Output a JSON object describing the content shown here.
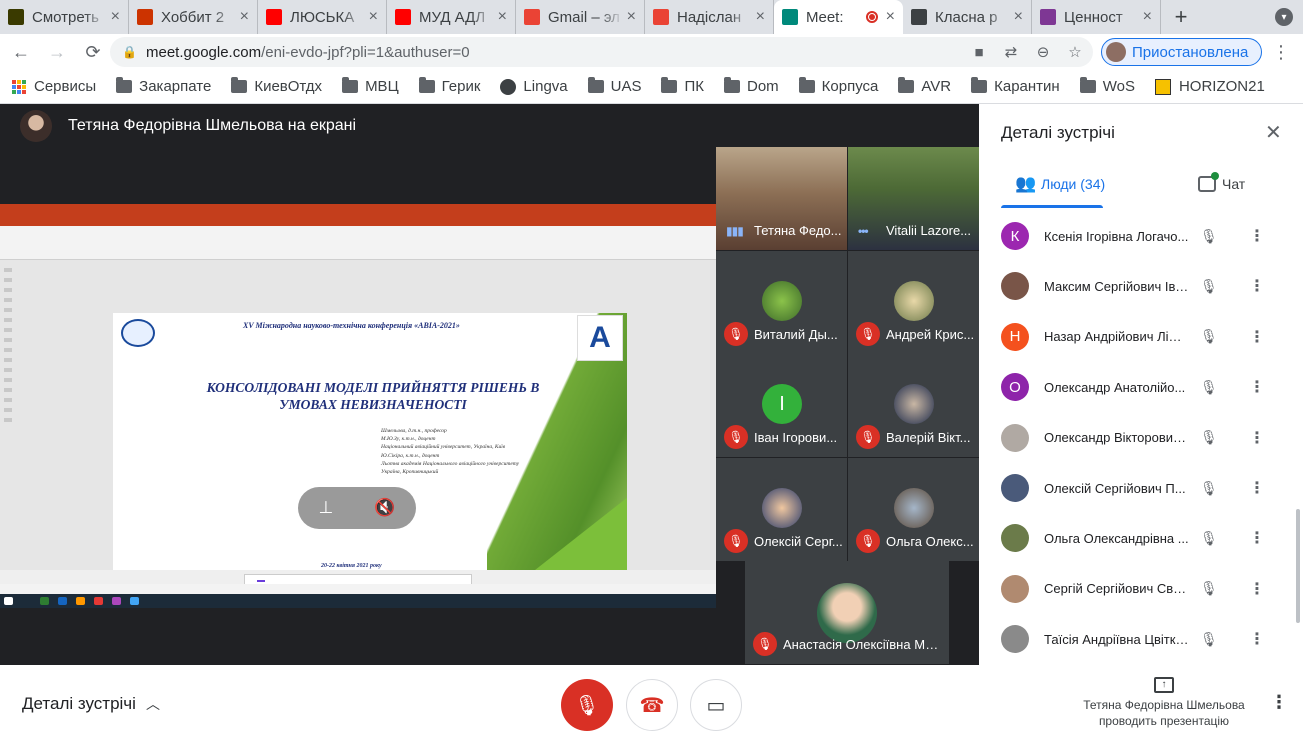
{
  "tabs": [
    {
      "title": "Смотреть",
      "icon": "d-favicon",
      "color": "#3a3a00"
    },
    {
      "title": "Хоббит 2",
      "icon": "k-favicon",
      "color": "#cc3300"
    },
    {
      "title": "ЛЮСЬКА",
      "icon": "youtube-icon",
      "color": "#ff0000"
    },
    {
      "title": "МУД АДЛ",
      "icon": "youtube-icon",
      "color": "#ff0000"
    },
    {
      "title": "Gmail – эл",
      "icon": "gmail-icon",
      "color": "#ea4335"
    },
    {
      "title": "Надіслан",
      "icon": "gmail-icon",
      "color": "#ea4335"
    },
    {
      "title": "Meet:",
      "icon": "meet-icon",
      "color": "#00897b",
      "active": true
    },
    {
      "title": "Класна р",
      "icon": "classroom-icon",
      "color": "#3c4043"
    },
    {
      "title": "Ценност",
      "icon": "bookmark-icon",
      "color": "#7e3794"
    }
  ],
  "tab_close": "×",
  "new_tab": "+",
  "omnibox": {
    "host": "meet.google.com",
    "path": "/eni-evdo-jpf?pli=1&authuser=0"
  },
  "profile_label": "Приостановлена",
  "bookmarks": [
    "Сервисы",
    "Закарпате",
    "КиевОтдх",
    "МВЦ",
    "Герик",
    "Lingva",
    "UAS",
    "ПК",
    "Dom",
    "Корпуса",
    "AVR",
    "Карантин",
    "WoS",
    "HORIZON21"
  ],
  "stage": {
    "presenter_text": "Тетяна Федорівна Шмельова на екрані"
  },
  "slide": {
    "conference": "XV Міжнародна науково-технічна конференція «АВІА-2021»",
    "title_line1": "КОНСОЛІДОВАНІ МОДЕЛІ  ПРИЙНЯТТЯ РІШЕНЬ В",
    "title_line2": "УМОВАХ НЕВИЗНАЧЕНОСТІ",
    "authors": [
      "Шмельова, д.т.н., професор",
      "М.Ю.Зу, к.т.н., доцент",
      "Національний авіаційний університет, Україна, Київ",
      "Ю.Сікіра, к.т.н., доцент",
      "Льотна академія Національного авіаційного університету",
      "Україна, Кропивницький"
    ],
    "date": "20-22 квітня 2021 року",
    "logo_right": "A"
  },
  "tiles": [
    {
      "name": "Тетяна Федо...",
      "muted": false
    },
    {
      "name": "Vitalii Lazore...",
      "muted": false
    },
    {
      "name": "Виталий Ды...",
      "muted": true
    },
    {
      "name": "Андрей Крис...",
      "muted": true
    },
    {
      "name": "Іван Ігорови...",
      "muted": true,
      "initial": "І",
      "avatar_color": "#33b13b"
    },
    {
      "name": "Валерій Вікт...",
      "muted": true
    },
    {
      "name": "Олексій Серг...",
      "muted": true
    },
    {
      "name": "Ольга Олекс...",
      "muted": true
    },
    {
      "name": "Анастасія Олексіївна Ма...",
      "muted": true
    }
  ],
  "panel": {
    "title": "Деталі зустрічі",
    "tab_people": "Люди (34)",
    "tab_chat": "Чат",
    "people": [
      {
        "name": "Ксенія Ігорівна Логачо...",
        "initial": "К",
        "color": "#9c27b0"
      },
      {
        "name": "Максим Сергійович Іва...",
        "initial": "",
        "color": "#795548"
      },
      {
        "name": "Назар Андрійович Ліщ...",
        "initial": "Н",
        "color": "#f4511e"
      },
      {
        "name": "Олександр Анатолійо...",
        "initial": "О",
        "color": "#8e24aa"
      },
      {
        "name": "Олександр Вікторович...",
        "initial": "",
        "color": "#b0a9a3"
      },
      {
        "name": "Олексій Сергійович П...",
        "initial": "",
        "color": "#4a5a7a"
      },
      {
        "name": "Ольга Олександрівна ...",
        "initial": "",
        "color": "#6b7b4a"
      },
      {
        "name": "Сергій Сергійович Сви...",
        "initial": "",
        "color": "#b08a70"
      },
      {
        "name": "Таїсія Андріївна Цвітко...",
        "initial": "",
        "color": "#8a8a8a"
      }
    ]
  },
  "bottom": {
    "details_label": "Деталі зустрічі",
    "present_line1": "Тетяна Федорівна Шмельова",
    "present_line2": "проводить презентацію"
  }
}
